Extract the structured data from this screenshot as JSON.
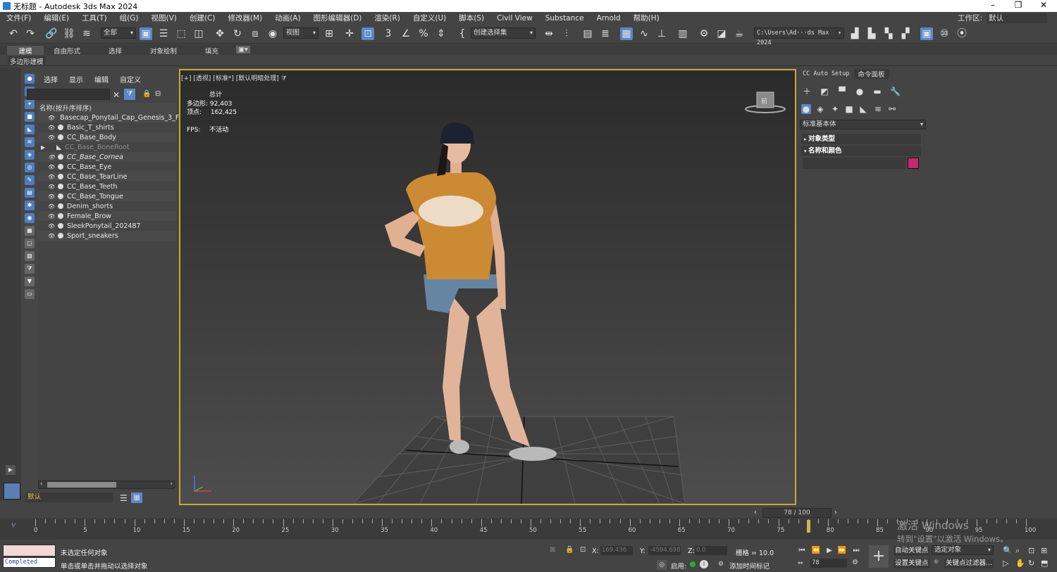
{
  "window": {
    "title": "无标题 - Autodesk 3ds Max 2024",
    "workspace_label": "工作区:",
    "workspace_value": "默认"
  },
  "menus": [
    "文件(F)",
    "编辑(E)",
    "工具(T)",
    "组(G)",
    "视图(V)",
    "创建(C)",
    "修改器(M)",
    "动画(A)",
    "图形编辑器(D)",
    "渲染(R)",
    "自定义(U)",
    "脚本(S)",
    "Civil View",
    "Substance",
    "Arnold",
    "帮助(H)"
  ],
  "toolbar": {
    "selection_filter": "全部",
    "ref_coord": "视图",
    "named_sel": "创建选择集",
    "project_path": "C:\\Users\\Ad···ds Max 2024"
  },
  "ribbon_tabs": [
    "建模",
    "自由形式",
    "选择",
    "对象绘制",
    "填充"
  ],
  "poly_label": "多边形建模",
  "scene_explorer": {
    "menu": [
      "选择",
      "显示",
      "编辑",
      "自定义"
    ],
    "header": "名称(按升序排序)",
    "items": [
      "Basecap_Ponytail_Cap_Genesis_3_F",
      "Basic_T_shirts",
      "CC_Base_Body",
      "CC_Base_BoneRoot",
      "CC_Base_Cornea",
      "CC_Base_Eye",
      "CC_Base_TearLine",
      "CC_Base_Teeth",
      "CC_Base_Tongue",
      "Denim_shorts",
      "Female_Brow",
      "SleekPonytail_202487",
      "Sport_sneakers"
    ],
    "layer": "默认"
  },
  "viewport": {
    "label": "[+] [透视] [标准*] [默认明暗处理]",
    "stats_total": "总计",
    "poly_label": "多边形:",
    "poly_value": "92,403",
    "vert_label": "顶点:",
    "vert_value": "162,425",
    "fps_label": "FPS:",
    "fps_value": "不活动",
    "viewcube_label": "前"
  },
  "command_panel": {
    "tabs": [
      "CC Auto Setup",
      "命令面板"
    ],
    "category": "标准基本体",
    "rollout_object_type": "对象类型",
    "rollout_name_color": "名称和颜色",
    "object_color": "#c8286e"
  },
  "timeline": {
    "frame_display": "78 / 100",
    "ticks": [
      "0",
      "5",
      "10",
      "15",
      "20",
      "25",
      "30",
      "35",
      "40",
      "45",
      "50",
      "55",
      "60",
      "65",
      "70",
      "75",
      "80",
      "85",
      "90",
      "95",
      "100"
    ],
    "current_frame": 78
  },
  "statusbar": {
    "maxscript_status": "Completed",
    "msg1": "未选定任何对象",
    "msg2": "单击或单击并拖动以选择对象",
    "x_label": "X:",
    "x_value": "169.436",
    "y_label": "Y:",
    "y_value": "-4594.698",
    "z_label": "Z:",
    "z_value": "0.0",
    "grid": "栅格 = 10.0",
    "enable": "启用:",
    "add_tag": "添加时间标记",
    "auto_key": "自动关键点",
    "set_key": "设置关键点",
    "sel_obj": "选定对象",
    "key_filter": "关键点过滤器...",
    "frame_field": "78"
  },
  "watermark": {
    "line1": "激活 Windows",
    "line2": "转到\"设置\"以激活 Windows。"
  }
}
